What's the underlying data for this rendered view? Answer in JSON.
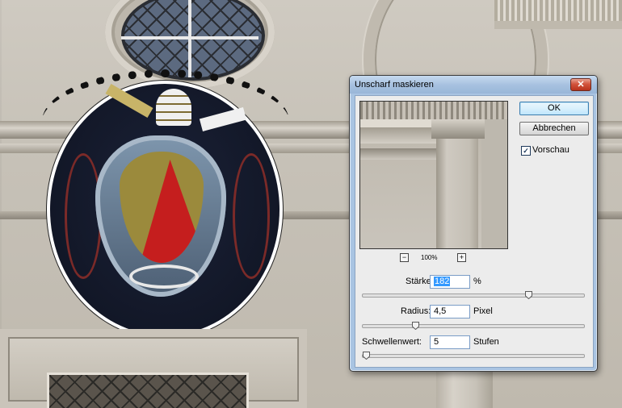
{
  "dialog": {
    "title": "Unscharf maskieren",
    "close_glyph": "✕",
    "zoom": {
      "minus": "−",
      "plus": "+",
      "level": "100%"
    },
    "buttons": {
      "ok": "OK",
      "cancel": "Abbrechen"
    },
    "preview_checkbox": {
      "label": "Vorschau",
      "checked": true,
      "check_glyph": "✓"
    },
    "fields": {
      "amount": {
        "label": "Stärke:",
        "value": "182",
        "unit": "%",
        "slider_fraction": 0.75
      },
      "radius": {
        "label": "Radius:",
        "value": "4,5",
        "unit": "Pixel",
        "slider_fraction": 0.24
      },
      "threshold": {
        "label": "Schwellenwert:",
        "value": "5",
        "unit": "Stufen",
        "slider_fraction": 0.02
      }
    }
  }
}
